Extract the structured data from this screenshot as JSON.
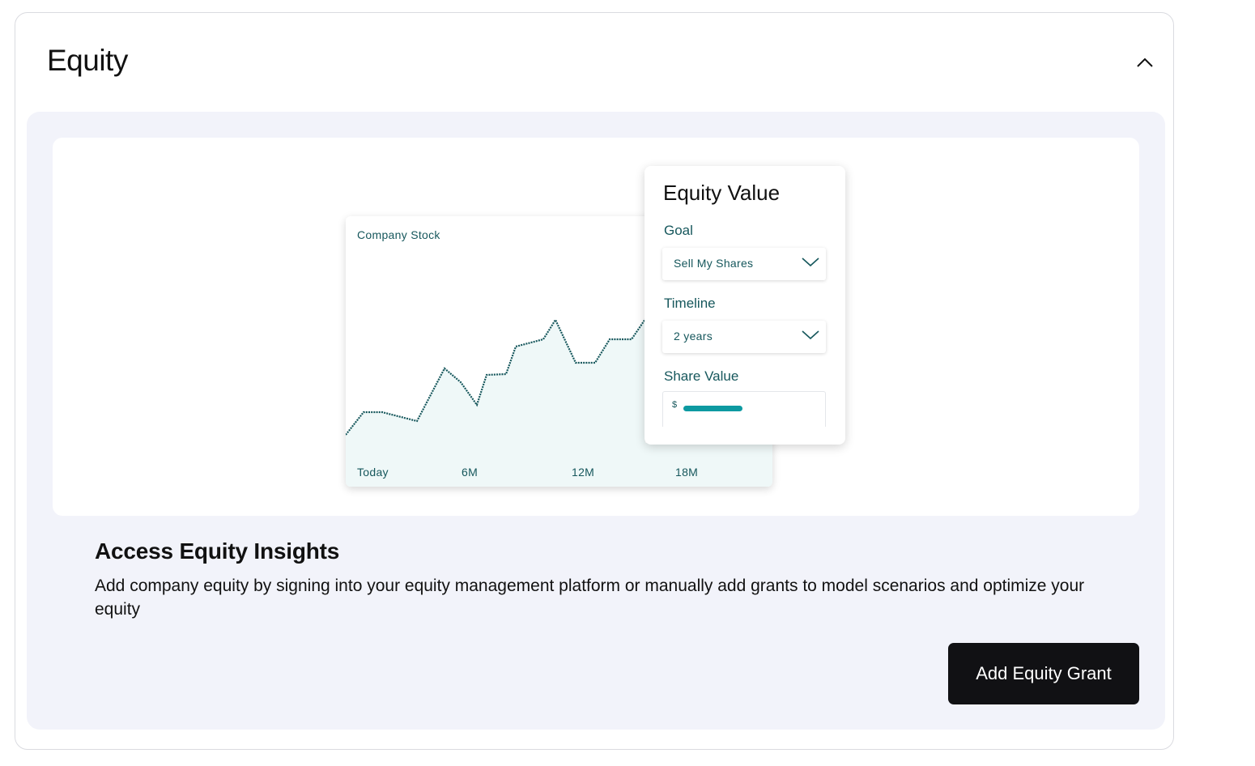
{
  "card": {
    "title": "Equity",
    "collapse_icon": "chevron-up-icon"
  },
  "illustration": {
    "stock_card": {
      "label": "Company Stock",
      "x_ticks": [
        "Today",
        "6M",
        "12M",
        "18M"
      ]
    },
    "equity_value": {
      "title": "Equity Value",
      "goal_label": "Goal",
      "goal_value": "Sell My Shares",
      "timeline_label": "Timeline",
      "timeline_value": "2 years",
      "share_value_label": "Share Value",
      "currency_symbol": "$"
    }
  },
  "insights": {
    "title": "Access Equity Insights",
    "description": "Add company equity by signing into your equity management platform or manually add grants to model scenarios and optimize your equity",
    "button_label": "Add Equity Grant"
  },
  "colors": {
    "teal_dark": "#16575c",
    "teal_accent": "#0d9aa1",
    "panel_bg": "#f2f3fa",
    "button_bg": "#111114"
  }
}
